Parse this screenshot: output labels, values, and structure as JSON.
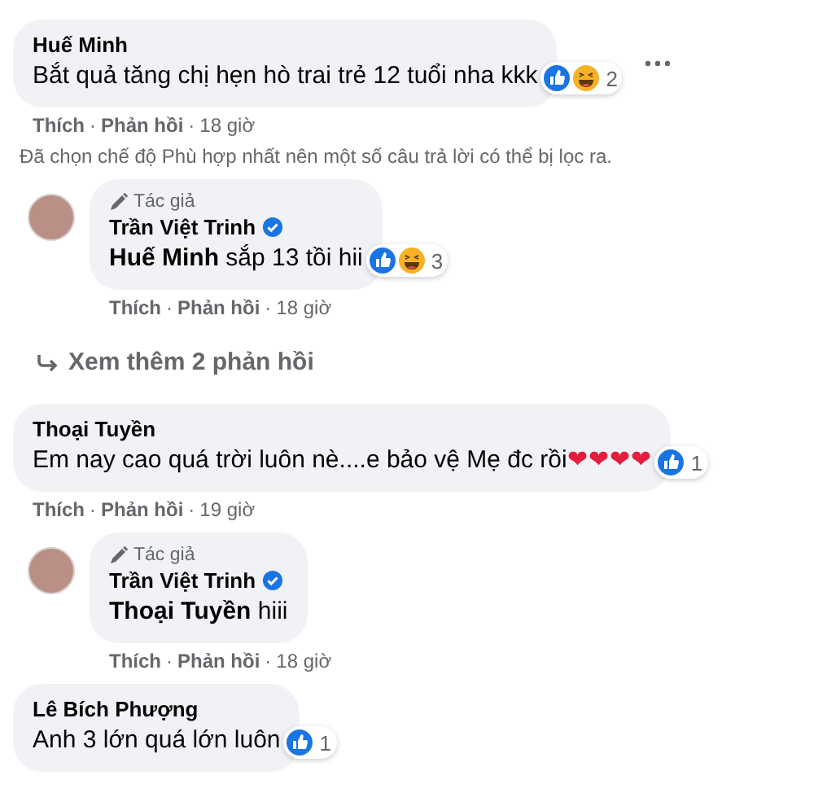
{
  "thread": [
    {
      "kind": "comment",
      "name": "Huế Minh",
      "text": "Bắt quả tăng chị hẹn hò trai trẻ 12 tuổi nha kkk",
      "reactions": [
        {
          "kind": "like"
        },
        {
          "kind": "haha"
        }
      ],
      "reaction_count": "2",
      "menu_shown": true,
      "meta": [
        "Thích",
        "·",
        "Phản hồi",
        "·",
        "18 giờ"
      ]
    },
    {
      "kind": "notice",
      "text": "Đã chọn chế độ Phù hợp nhất nên một số câu trả lời có thể bị lọc ra."
    },
    {
      "kind": "reply",
      "badge": "Tác giả",
      "name": "Trần Việt Trinh",
      "verified": true,
      "text": "**Huế Minh** sắp 13 tồi hii",
      "reactions": [
        {
          "kind": "like"
        },
        {
          "kind": "haha"
        }
      ],
      "reaction_count": "3",
      "meta": [
        "Thích",
        "·",
        "Phản hồi",
        "·",
        "18 giờ"
      ]
    },
    {
      "kind": "more_replies",
      "text": "Xem thêm 2 phản hồi"
    },
    {
      "kind": "comment",
      "name": "Thoại Tuyền",
      "text": "Em nay cao quá trời luôn nè....e bảo vệ Mẹ đc rồi❤❤❤❤",
      "reactions": [
        {
          "kind": "like"
        }
      ],
      "reaction_count": "1",
      "menu_shown": false,
      "meta": [
        "Thích",
        "·",
        "Phản hồi",
        "·",
        "19 giờ"
      ]
    },
    {
      "kind": "reply",
      "badge": "Tác giả",
      "name": "Trần Việt Trinh",
      "verified": true,
      "text": "**Thoại Tuyền** hiii",
      "meta": [
        "Thích",
        "·",
        "Phản hồi",
        "·",
        "18 giờ"
      ]
    },
    {
      "kind": "comment",
      "name": "Lê Bích Phượng",
      "text": "Anh 3 lớn quá lớn luôn",
      "reactions": [
        {
          "kind": "like"
        }
      ],
      "reaction_count": "1",
      "menu_shown": false
    }
  ]
}
